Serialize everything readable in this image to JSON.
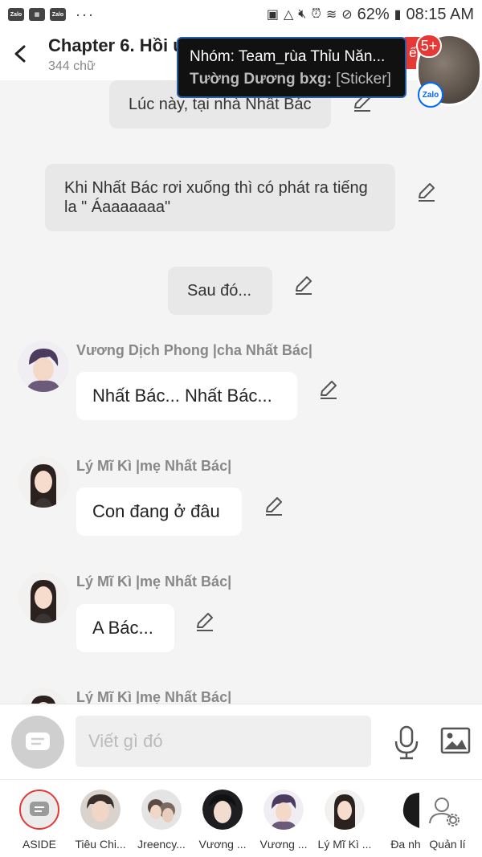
{
  "status_bar": {
    "left_icons": [
      "zalo-icon",
      "image-icon",
      "zalo-icon"
    ],
    "more": "···",
    "battery": "62%",
    "time": "08:15 AM"
  },
  "header": {
    "title": "Chapter 6. Hồi ứ",
    "subtitle": "344 chữ"
  },
  "notification": {
    "title": "Nhóm: Team_rùa Thỉu Năn...",
    "sender": "Tường Dương bxg:",
    "message": "[Sticker]",
    "badge_text": "ếp",
    "count": "5+",
    "zalo_badge": "Zalo"
  },
  "narrations": [
    {
      "text": "Lúc này, tại nhà Nhất Bác"
    },
    {
      "text": "Khi Nhất Bác rơi xuống thì có phát ra tiếng la \" Áaaaaaaa\""
    },
    {
      "text": "Sau đó..."
    }
  ],
  "messages": [
    {
      "name": "Vương Dịch Phong |cha Nhất Bác|",
      "text": "Nhất Bác... Nhất Bác..."
    },
    {
      "name": "Lý Mĩ Kì |mẹ Nhất Bác|",
      "text": "Con đang ở đâu"
    },
    {
      "name": "Lý Mĩ Kì |mẹ Nhất Bác|",
      "text": "A Bác..."
    },
    {
      "name": "Lý Mĩ Kì |mẹ Nhất Bác|",
      "text": ""
    }
  ],
  "input": {
    "placeholder": "Viết gì đó"
  },
  "characters": [
    {
      "label": "ASIDE"
    },
    {
      "label": "Tiêu Chi..."
    },
    {
      "label": "Jreency..."
    },
    {
      "label": "Vương ..."
    },
    {
      "label": "Vương ..."
    },
    {
      "label": "Lý Mĩ Kì ..."
    },
    {
      "label": "Đa nh"
    },
    {
      "label": "Quản lí"
    }
  ],
  "colors": {
    "accent_red": "#e53935",
    "zalo_blue": "#0068ff",
    "bubble_narration": "#e8e8e8",
    "chat_background": "#f4f4f4"
  }
}
